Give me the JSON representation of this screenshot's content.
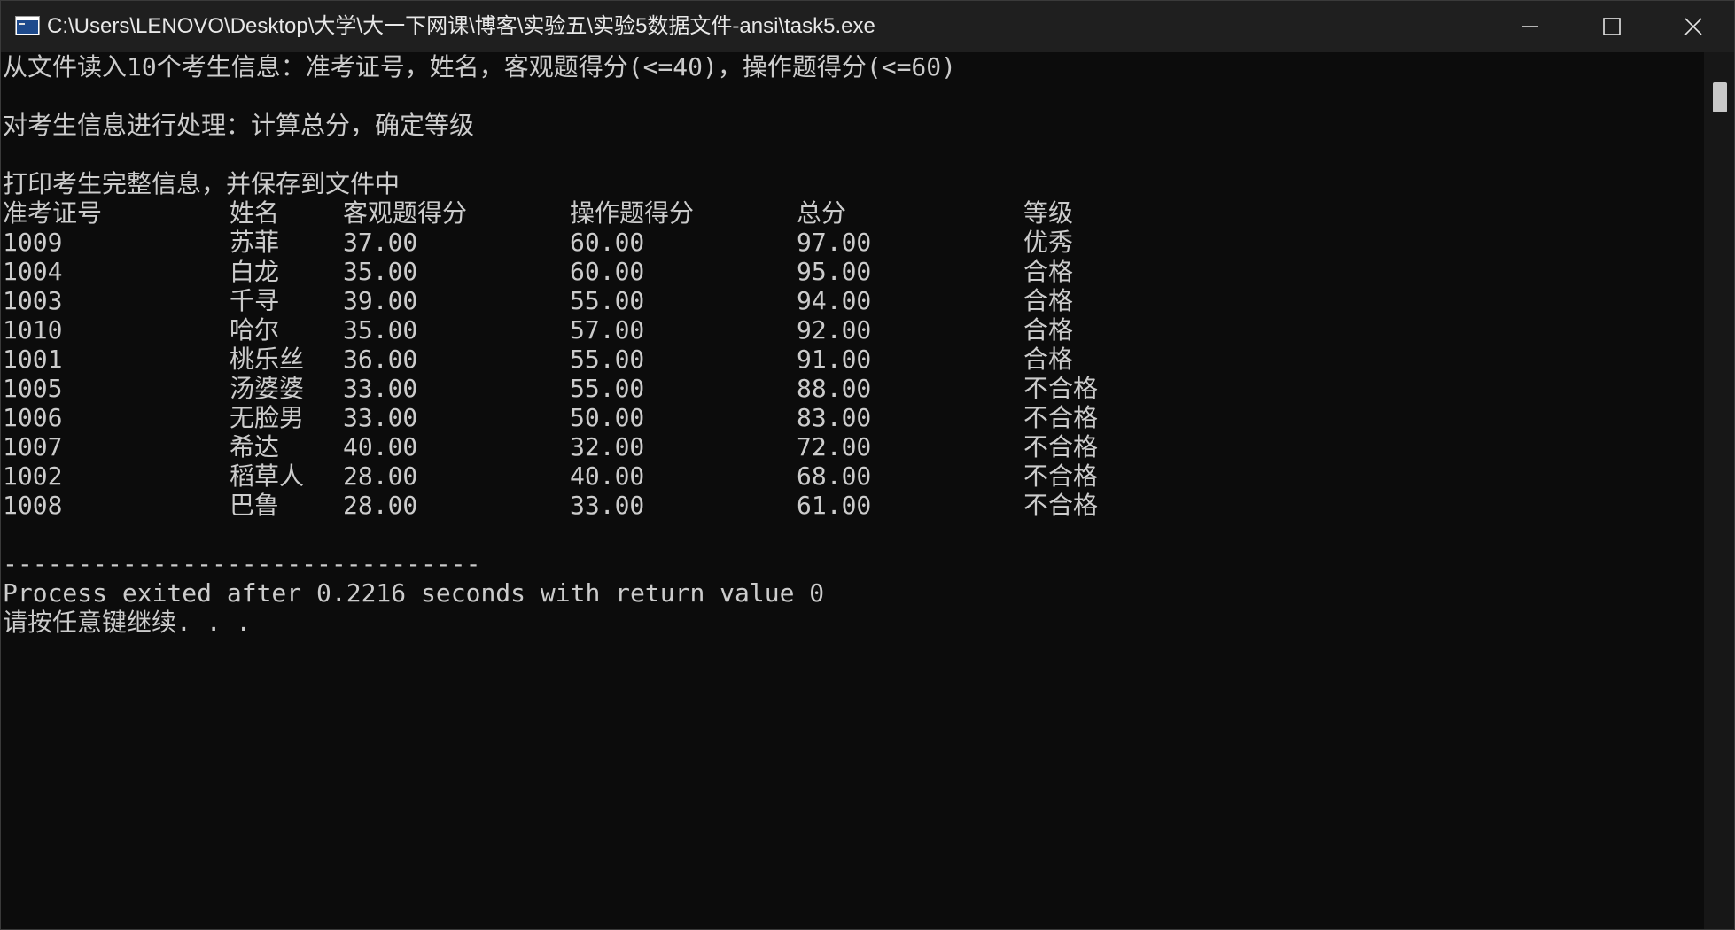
{
  "window": {
    "title": "C:\\Users\\LENOVO\\Desktop\\大学\\大一下网课\\博客\\实验五\\实验5数据文件-ansi\\task5.exe"
  },
  "console": {
    "line1": "从文件读入10个考生信息：准考证号，姓名，客观题得分(<=40)，操作题得分(<=60)",
    "line2": "对考生信息进行处理：计算总分，确定等级",
    "line3": "打印考生完整信息，并保存到文件中",
    "headers": [
      "准考证号",
      "姓名",
      "客观题得分",
      "操作题得分",
      "总分",
      "等级"
    ],
    "rows": [
      [
        "1009",
        "苏菲",
        "37.00",
        "60.00",
        "97.00",
        "优秀"
      ],
      [
        "1004",
        "白龙",
        "35.00",
        "60.00",
        "95.00",
        "合格"
      ],
      [
        "1003",
        "千寻",
        "39.00",
        "55.00",
        "94.00",
        "合格"
      ],
      [
        "1010",
        "哈尔",
        "35.00",
        "57.00",
        "92.00",
        "合格"
      ],
      [
        "1001",
        "桃乐丝",
        "36.00",
        "55.00",
        "91.00",
        "合格"
      ],
      [
        "1005",
        "汤婆婆",
        "33.00",
        "55.00",
        "88.00",
        "不合格"
      ],
      [
        "1006",
        "无脸男",
        "33.00",
        "50.00",
        "83.00",
        "不合格"
      ],
      [
        "1007",
        "希达",
        "40.00",
        "32.00",
        "72.00",
        "不合格"
      ],
      [
        "1002",
        "稻草人",
        "28.00",
        "40.00",
        "68.00",
        "不合格"
      ],
      [
        "1008",
        "巴鲁",
        "28.00",
        "33.00",
        "61.00",
        "不合格"
      ]
    ],
    "separator": "--------------------------------",
    "exit_message": "Process exited after 0.2216 seconds with return value 0",
    "prompt": "请按任意键继续. . ."
  },
  "colors": {
    "background": "#0c0c0c",
    "text": "#cccccc",
    "titlebar": "#1f1f1f"
  },
  "icons": [
    "console-app-icon",
    "minimize-icon",
    "maximize-icon",
    "close-icon"
  ]
}
